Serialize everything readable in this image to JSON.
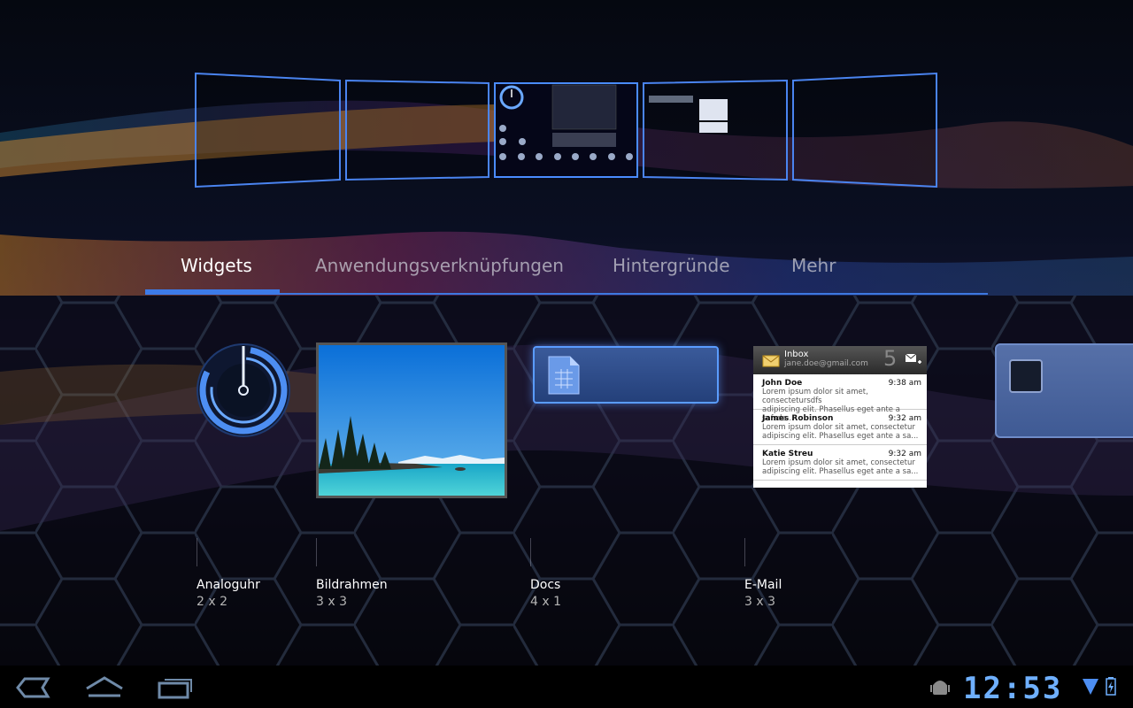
{
  "tabs": {
    "widgets": "Widgets",
    "shortcuts": "Anwendungsverknüpfungen",
    "wallpapers": "Hintergründe",
    "more": "Mehr"
  },
  "widgets": [
    {
      "name": "Analoguhr",
      "size": "2 x 2"
    },
    {
      "name": "Bildrahmen",
      "size": "3 x 3"
    },
    {
      "name": "Docs",
      "size": "4 x 1"
    },
    {
      "name": "E-Mail",
      "size": "3 x 3"
    }
  ],
  "email_preview": {
    "inbox": "Inbox",
    "account": "jane.doe@gmail.com",
    "unread_count": "5",
    "messages": [
      {
        "from": "John Doe",
        "time": "9:38 am",
        "line1": "Lorem ipsum dolor sit amet, consectetursdfs",
        "line2": "adipiscing elit. Phasellus eget ante a safsda..."
      },
      {
        "from": "James Robinson",
        "time": "9:32 am",
        "line1": "Lorem ipsum dolor sit amet, consectetur",
        "line2": "adipiscing elit. Phasellus eget ante a sa..."
      },
      {
        "from": "Katie Streu",
        "time": "9:32 am",
        "line1": "Lorem ipsum dolor sit amet, consectetur",
        "line2": "adipiscing elit. Phasellus eget ante a sa..."
      }
    ]
  },
  "status_bar": {
    "time": "12:53",
    "icons": [
      "android-debug-icon",
      "wifi-icon",
      "battery-charging-icon"
    ]
  },
  "nav": {
    "icons": [
      "back-icon",
      "home-icon",
      "recent-apps-icon"
    ]
  },
  "colors": {
    "accent": "#3d7be8",
    "clock": "#6fb0ff"
  }
}
